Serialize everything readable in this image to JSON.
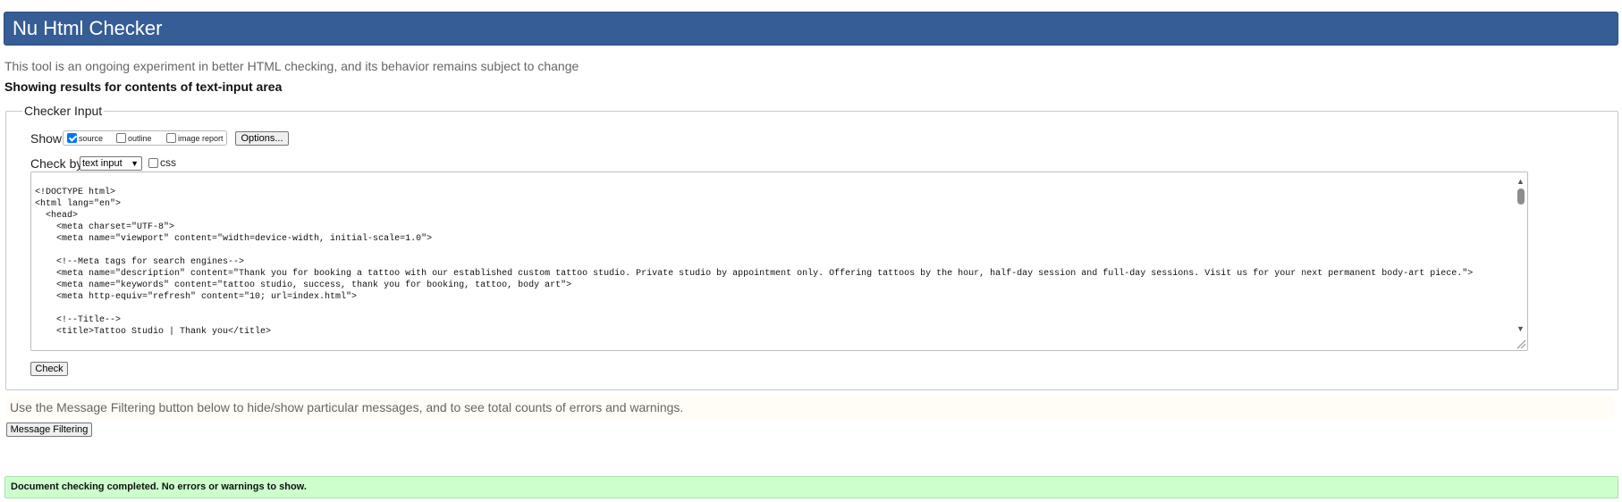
{
  "header": {
    "title": "Nu Html Checker"
  },
  "intro": "This tool is an ongoing experiment in better HTML checking, and its behavior remains subject to change",
  "results_heading": "Showing results for contents of text-input area",
  "checker_input": {
    "legend": "Checker Input",
    "show_label": "Show",
    "show_options": [
      {
        "label": "source",
        "checked": true
      },
      {
        "label": "outline",
        "checked": false
      },
      {
        "label": "image report",
        "checked": false
      }
    ],
    "options_button": "Options...",
    "check_by_label": "Check by",
    "check_by_value": "text input",
    "css_label": "css",
    "css_checked": false,
    "source_lines": [
      "<!DOCTYPE html>",
      "<html lang=\"en\">",
      "  <head>",
      "    <meta charset=\"UTF-8\">",
      "    <meta name=\"viewport\" content=\"width=device-width, initial-scale=1.0\">",
      "",
      "    <!--Meta tags for search engines-->",
      "    <meta name=\"description\" content=\"Thank you for booking a tattoo with our established custom tattoo studio. Private studio by appointment only. Offering tattoos by the hour, half-day session and full-day sessions. Visit us for your next permanent body-art piece.\">",
      "    <meta name=\"keywords\" content=\"tattoo studio, success, thank you for booking, tattoo, body art\">",
      "    <meta http-equiv=\"refresh\" content=\"10; url=index.html\">",
      "",
      "    <!--Title-->",
      "    <title>Tattoo Studio | Thank you</title>"
    ],
    "check_button": "Check"
  },
  "filter_note": "Use the Message Filtering button below to hide/show particular messages, and to see total counts of errors and warnings.",
  "filter_button": "Message Filtering",
  "status": "Document checking completed. No errors or warnings to show.",
  "colors": {
    "header_bg": "#365d95",
    "status_bg": "#ccffcc",
    "checkbox_checked": "#0075ff"
  },
  "icons": {
    "scroll_up": "triangle-up-icon",
    "scroll_down": "triangle-down-icon",
    "select_chevron": "chevron-down-icon",
    "resize": "resize-grip-icon"
  }
}
